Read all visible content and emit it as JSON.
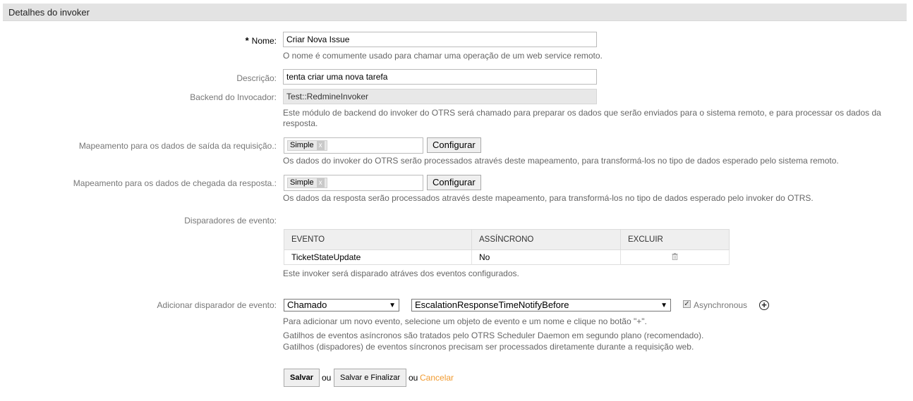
{
  "panel": {
    "title": "Detalhes do invoker"
  },
  "name": {
    "label": "Nome:",
    "value": "Criar Nova Issue",
    "hint": "O nome é comumente usado para chamar uma operação de um web service remoto."
  },
  "description": {
    "label": "Descrição:",
    "value": "tenta criar uma nova tarefa"
  },
  "backend": {
    "label": "Backend do Invocador:",
    "value": "Test::RedmineInvoker",
    "hint": "Este módulo de backend do invoker do OTRS será chamado para preparar os dados que serão enviados para o sistema remoto, e para processar os dados da resposta."
  },
  "outbound_mapping": {
    "label": "Mapeamento para os dados de saída da requisição.:",
    "tag": "Simple",
    "tag_remove": "x",
    "button": "Configurar",
    "hint": "Os dados do invoker do OTRS serão processados através deste mapeamento, para transformá-los no tipo de dados esperado pelo sistema remoto."
  },
  "inbound_mapping": {
    "label": "Mapeamento para os dados de chegada da resposta.:",
    "tag": "Simple",
    "tag_remove": "x",
    "button": "Configurar",
    "hint": "Os dados da resposta serão processados através deste mapeamento, para transformá-los no tipo de dados esperado pelo invoker do OTRS."
  },
  "event_triggers": {
    "label": "Disparadores de evento:",
    "columns": [
      "EVENTO",
      "ASSÍNCRONO",
      "EXCLUIR"
    ],
    "rows": [
      {
        "event": "TicketStateUpdate",
        "async": "No"
      }
    ],
    "hint": "Este invoker será disparado atráves dos eventos configurados."
  },
  "add_trigger": {
    "label": "Adicionar disparador de evento:",
    "object_value": "Chamado",
    "event_value": "EscalationResponseTimeNotifyBefore",
    "async_label": "Asynchronous",
    "hint1": "Para adicionar um novo evento, selecione um objeto de evento e um nome e clique no botão \"+\".",
    "hint2": "Gatilhos de eventos asíncronos são tratados pelo OTRS Scheduler Daemon em segundo plano (recomendado).",
    "hint3": "Gatilhos (dispadores) de eventos síncronos precisam ser processados diretamente durante a requisição web."
  },
  "actions": {
    "save": "Salvar",
    "or1": "ou",
    "save_finish": "Salvar e Finalizar",
    "or2": "ou",
    "cancel": "Cancelar"
  },
  "colors": {
    "accent_link": "#f19a2f",
    "header_bg": "#e3e3e3"
  }
}
